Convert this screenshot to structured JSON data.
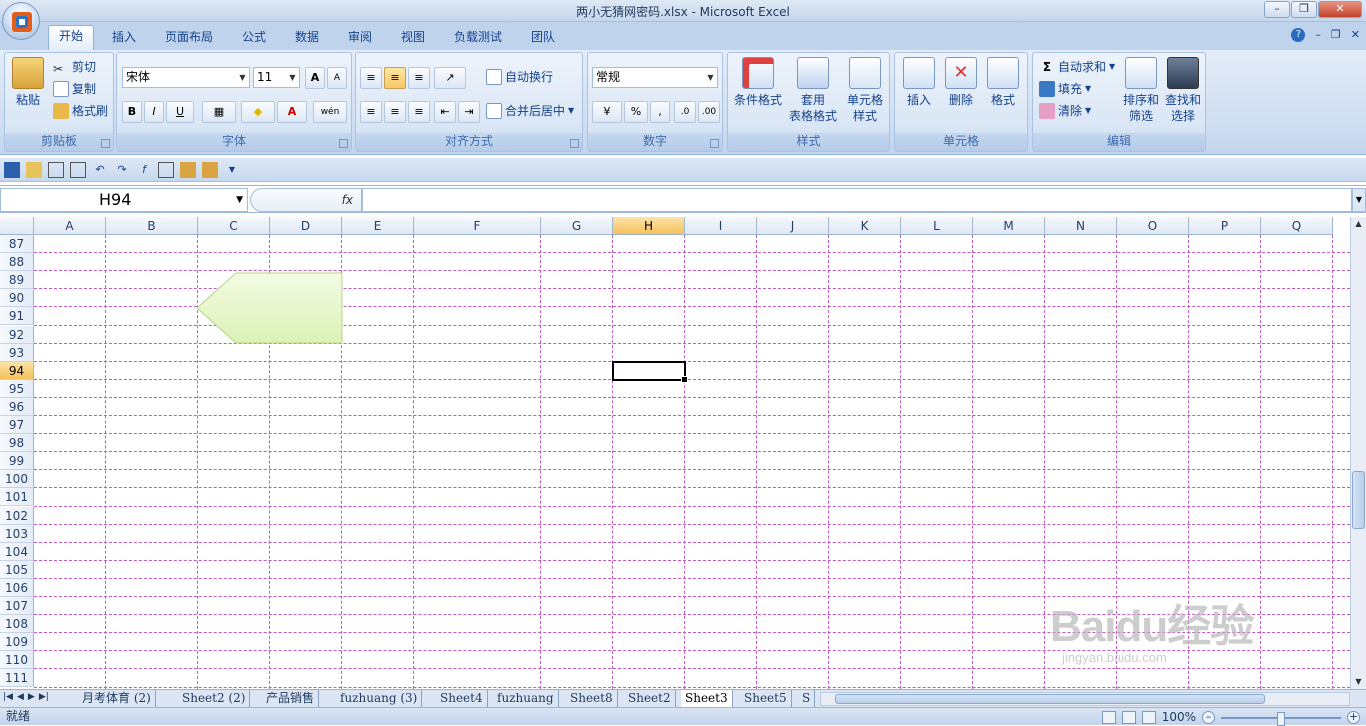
{
  "window": {
    "title": "两小无猜网密码.xlsx - Microsoft Excel"
  },
  "ribbon_tabs": [
    "开始",
    "插入",
    "页面布局",
    "公式",
    "数据",
    "审阅",
    "视图",
    "负载测试",
    "团队"
  ],
  "clipboard": {
    "paste": "粘贴",
    "cut": "剪切",
    "copy": "复制",
    "format_painter": "格式刷",
    "label": "剪贴板"
  },
  "font": {
    "name": "宋体",
    "size": "11",
    "label": "字体",
    "bold": "B",
    "italic": "I",
    "underline": "U",
    "grow": "A",
    "shrink": "A",
    "font_color": "A",
    "phonetic": "wén"
  },
  "alignment": {
    "wrap": "自动换行",
    "merge": "合并后居中",
    "label": "对齐方式"
  },
  "number": {
    "format": "常规",
    "percent": "%",
    "comma": ",",
    "label": "数字"
  },
  "styles": {
    "conditional": "条件格式",
    "table_line1": "套用",
    "table_line2": "表格格式",
    "cell_line1": "单元格",
    "cell_line2": "样式",
    "label": "样式"
  },
  "cells": {
    "insert": "插入",
    "delete": "删除",
    "format": "格式",
    "label": "单元格"
  },
  "editing": {
    "sum_symbol": "Σ",
    "autosum": "自动求和",
    "fill": "填充",
    "clear": "清除",
    "sort_line1": "排序和",
    "sort_line2": "筛选",
    "find_line1": "查找和",
    "find_line2": "选择",
    "label": "编辑"
  },
  "formula_bar": {
    "name_box": "H94",
    "fx": "fx"
  },
  "columns": [
    "A",
    "B",
    "C",
    "D",
    "E",
    "F",
    "G",
    "H",
    "I",
    "J",
    "K",
    "L",
    "M",
    "N",
    "O",
    "P",
    "Q"
  ],
  "rows": [
    "87",
    "88",
    "89",
    "90",
    "91",
    "92",
    "93",
    "94",
    "95",
    "96",
    "97",
    "98",
    "99",
    "100",
    "101",
    "102",
    "103",
    "104",
    "105",
    "106",
    "107",
    "108",
    "109",
    "110",
    "111"
  ],
  "selected": {
    "column": "H",
    "row": "94"
  },
  "sheets": [
    "月考体育 (2)",
    "Sheet2 (2)",
    "产品销售",
    "fuzhuang (3)",
    "Sheet4",
    "fuzhuang",
    "Sheet8",
    "Sheet2",
    "Sheet3",
    "Sheet5",
    "S"
  ],
  "active_sheet": "Sheet3",
  "status": {
    "ready": "就绪",
    "zoom": "100%"
  },
  "watermark": {
    "brand": "Baidu经验",
    "url": "jingyan.baidu.com"
  },
  "colors": {
    "gridline": "#c25ac2",
    "shape_fill": "#e6f7c4",
    "accent": "#15428b"
  }
}
